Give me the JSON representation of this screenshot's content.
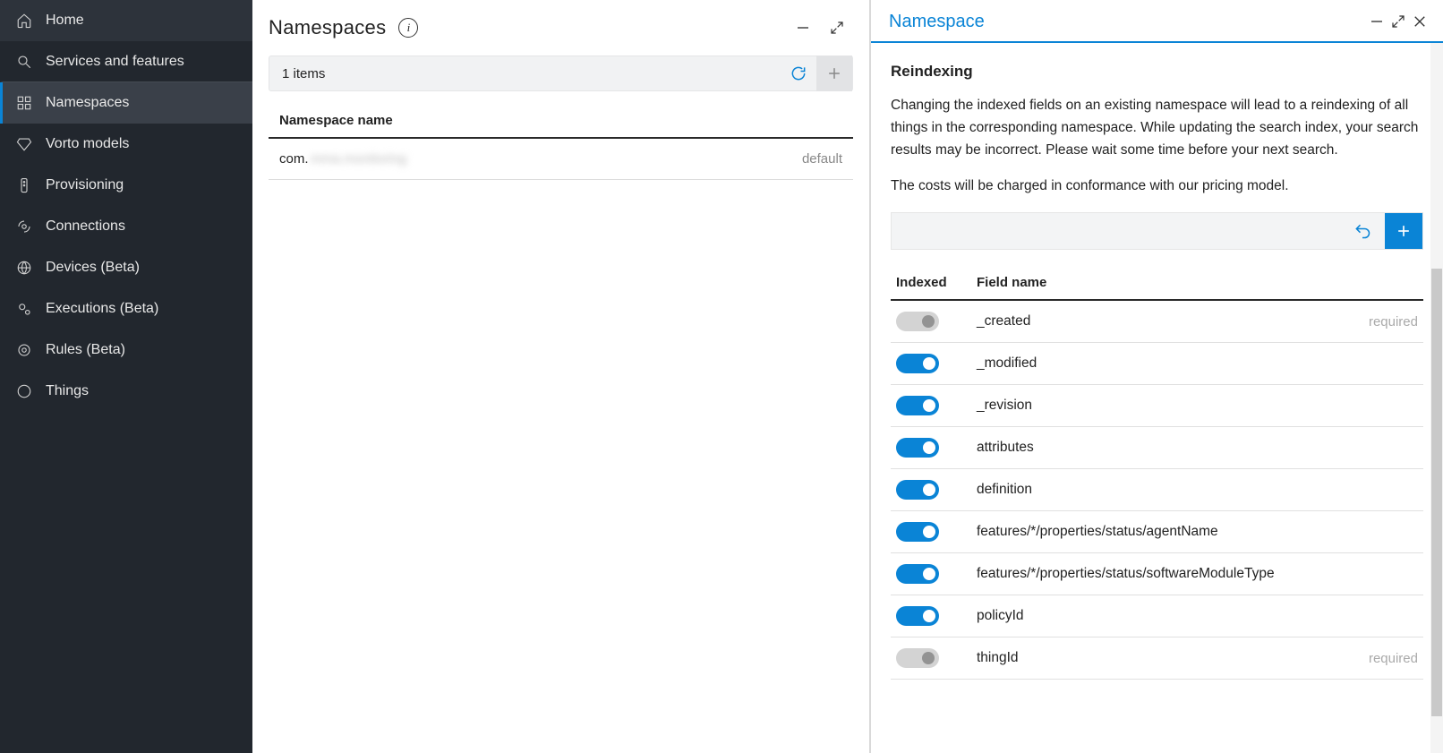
{
  "sidebar": {
    "items": [
      {
        "label": "Home",
        "icon": "home"
      },
      {
        "label": "Services and features",
        "icon": "search"
      },
      {
        "label": "Namespaces",
        "icon": "grid"
      },
      {
        "label": "Vorto models",
        "icon": "diamond"
      },
      {
        "label": "Provisioning",
        "icon": "remote"
      },
      {
        "label": "Connections",
        "icon": "satellite"
      },
      {
        "label": "Devices (Beta)",
        "icon": "globe"
      },
      {
        "label": "Executions (Beta)",
        "icon": "gears"
      },
      {
        "label": "Rules (Beta)",
        "icon": "target"
      },
      {
        "label": "Things",
        "icon": "circle"
      }
    ]
  },
  "center": {
    "title": "Namespaces",
    "items_label": "1 items",
    "column_header": "Namespace name",
    "rows": [
      {
        "name_prefix": "com.",
        "name_blurred": "mma.monitoring",
        "tag": "default"
      }
    ]
  },
  "right": {
    "title": "Namespace",
    "section_title": "Reindexing",
    "paragraph1": "Changing the indexed fields on an existing namespace will lead to a reindexing of all things in the corresponding namespace. While updating the search index, your search results may be incorrect. Please wait some time before your next search.",
    "paragraph2": "The costs will be charged in conformance with our pricing model.",
    "fields_header_indexed": "Indexed",
    "fields_header_name": "Field name",
    "required_label": "required",
    "fields": [
      {
        "name": "_created",
        "on": false,
        "disabled": true,
        "required": true
      },
      {
        "name": "_modified",
        "on": true,
        "disabled": false,
        "required": false
      },
      {
        "name": "_revision",
        "on": true,
        "disabled": false,
        "required": false
      },
      {
        "name": "attributes",
        "on": true,
        "disabled": false,
        "required": false
      },
      {
        "name": "definition",
        "on": true,
        "disabled": false,
        "required": false
      },
      {
        "name": "features/*/properties/status/agentName",
        "on": true,
        "disabled": false,
        "required": false
      },
      {
        "name": "features/*/properties/status/softwareModuleType",
        "on": true,
        "disabled": false,
        "required": false
      },
      {
        "name": "policyId",
        "on": true,
        "disabled": false,
        "required": false
      },
      {
        "name": "thingId",
        "on": false,
        "disabled": true,
        "required": true
      }
    ]
  }
}
